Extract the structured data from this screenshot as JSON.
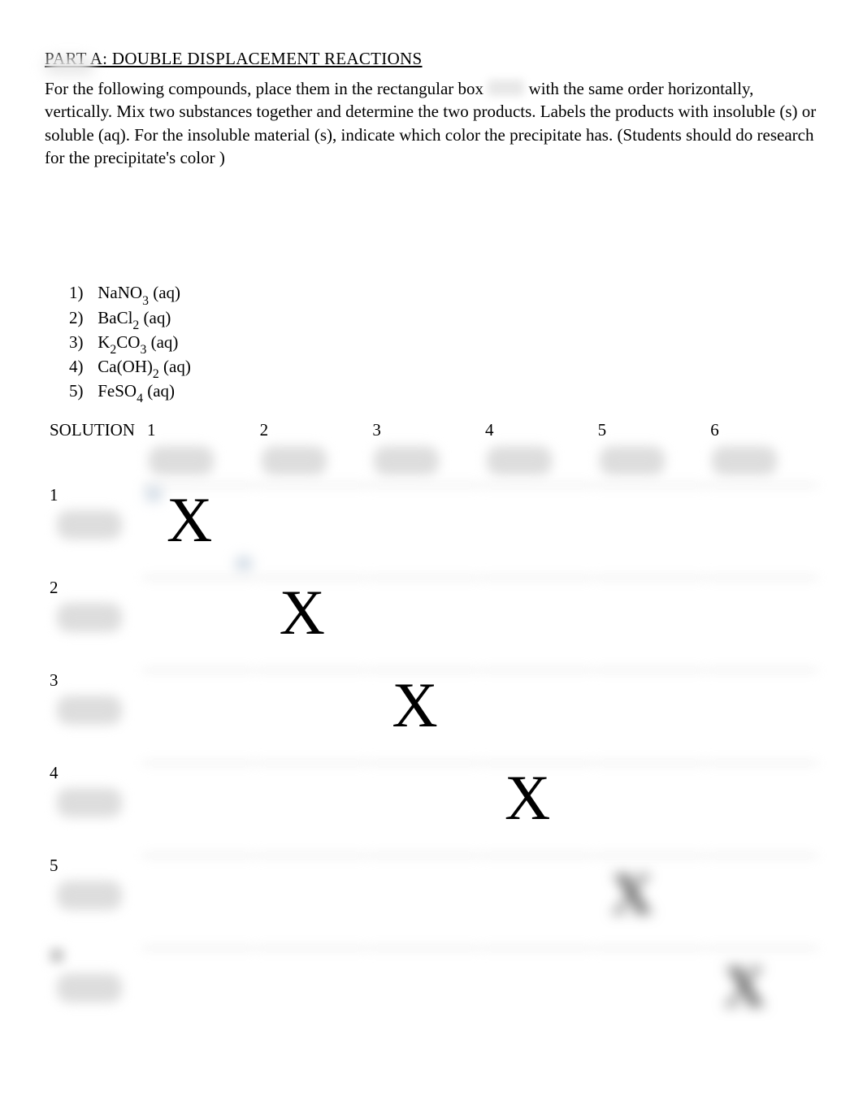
{
  "title": "PART A: DOUBLE DISPLACEMENT REACTIONS",
  "instructions": {
    "part1": "For the following compounds, place them in the rectangular box ",
    "part2": " with the same order horizontally, vertically.   Mix two substances together and determine the two products.     Labels the products with insoluble (s) or soluble (aq).  For the insoluble material (s), indicate which color the precipitate has. (Students should do research for the precipitate's color  )"
  },
  "compounds": [
    {
      "num": "1)",
      "formula_parts": [
        "NaNO",
        "3",
        " (aq)"
      ]
    },
    {
      "num": "2)",
      "formula_parts": [
        "BaCl",
        "2",
        " (aq)"
      ]
    },
    {
      "num": "3)",
      "formula_parts": [
        "K",
        "2",
        "CO",
        "3",
        " (aq)"
      ]
    },
    {
      "num": "4)",
      "formula_parts": [
        "Ca(OH)",
        "2",
        " (aq)"
      ]
    },
    {
      "num": "5)",
      "formula_parts": [
        "FeSO",
        "4",
        " (aq)"
      ]
    }
  ],
  "table": {
    "header_label": "SOLUTION",
    "columns": [
      "1",
      "2",
      "3",
      "4",
      "5",
      "6"
    ],
    "rows": [
      "1",
      "2",
      "3",
      "4",
      "5",
      "6"
    ],
    "diagonal_marks": {
      "1": "X",
      "2": "X",
      "3": "X",
      "4": "X",
      "5": "X",
      "6": "X"
    }
  }
}
